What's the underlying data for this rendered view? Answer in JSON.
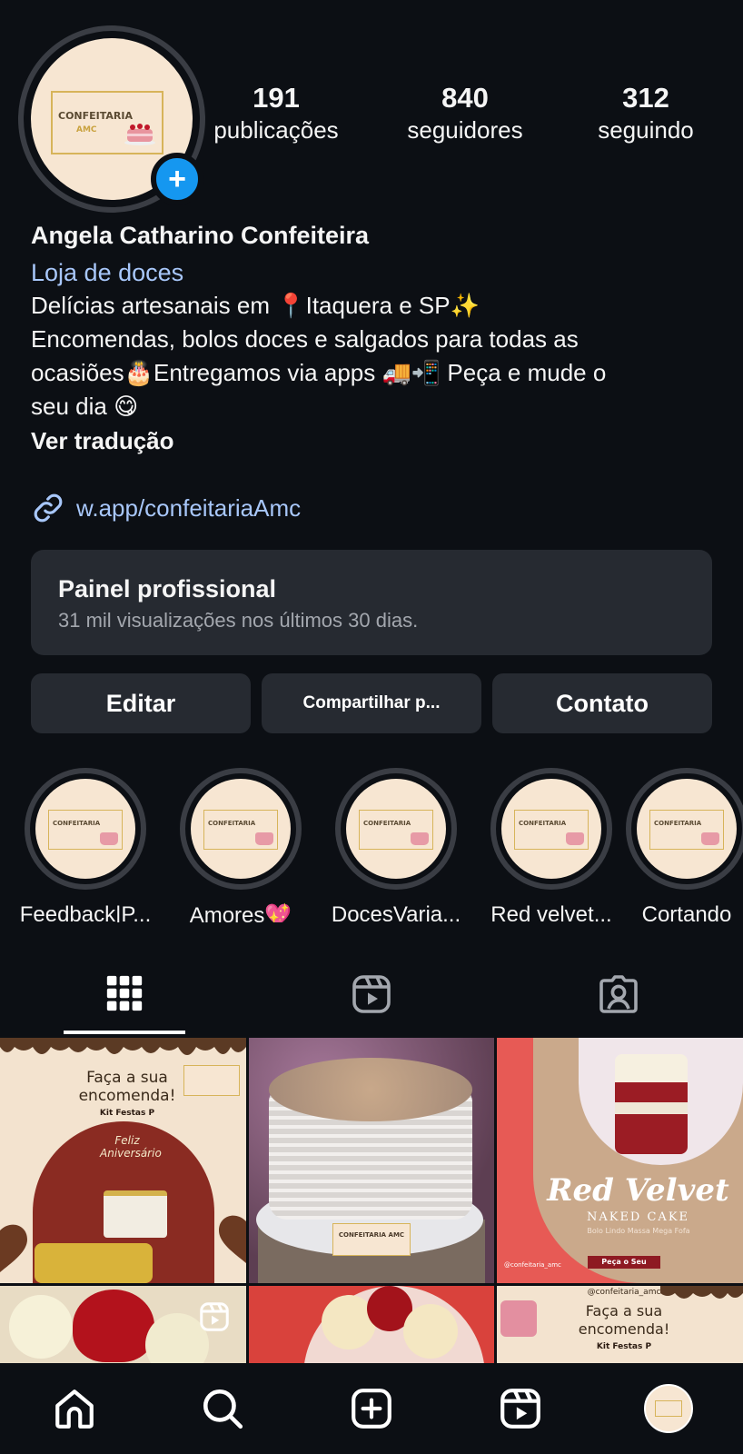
{
  "profile": {
    "name": "Angela Catharino Confeiteira",
    "category": "Loja de doces",
    "bio_lines": [
      "Delícias artesanais em 📍Itaquera e SP✨",
      "Encomendas, bolos doces e salgados para todas as",
      "ocasiões🎂Entregamos via apps 🚚📲 Peça e mude o",
      "seu dia 😋"
    ],
    "translate_label": "Ver tradução",
    "link": "w.app/confeitariaAmc",
    "logo_text": "CONFEITARIA",
    "logo_sub": "AMC"
  },
  "stats": [
    {
      "value": "191",
      "label": "publicações"
    },
    {
      "value": "840",
      "label": "seguidores"
    },
    {
      "value": "312",
      "label": "seguindo"
    }
  ],
  "panel": {
    "title": "Painel profissional",
    "subtitle": "31 mil visualizações nos últimos 30 dias."
  },
  "actions": {
    "edit": "Editar",
    "share": "Compartilhar p...",
    "contact": "Contato"
  },
  "highlights": [
    {
      "label": "Feedback|P..."
    },
    {
      "label": "Amores💖"
    },
    {
      "label": "DocesVaria..."
    },
    {
      "label": "Red velvet..."
    },
    {
      "label": "Cortando"
    }
  ],
  "tabs": [
    {
      "icon": "grid-icon",
      "active": true
    },
    {
      "icon": "reels-icon",
      "active": false
    },
    {
      "icon": "tagged-icon",
      "active": false
    }
  ],
  "posts": {
    "p1_title": "Faça a sua encomenda!",
    "p1_sub": "Kit Festas P",
    "p1_cake": "Feliz Aniversário",
    "p2_logo": "CONFEITARIA AMC",
    "p3_title": "Red Velvet",
    "p3_sub": "NAKED CAKE",
    "p3_desc": "Bolo Lindo Massa Mega Fofa",
    "p3_cta": "Peça o Seu",
    "p3_handle": "@confeitaria_amc",
    "p6_handle": "@confeitaria_amc",
    "p6_title": "Faça a sua encomenda!",
    "p6_sub": "Kit Festas P"
  },
  "nav": [
    "home-icon",
    "search-icon",
    "create-icon",
    "reels-icon",
    "profile-avatar"
  ],
  "colors": {
    "background": "#0c0f14",
    "accent_blue": "#1597f0",
    "link": "#a8c7fa",
    "card": "#262a31"
  }
}
